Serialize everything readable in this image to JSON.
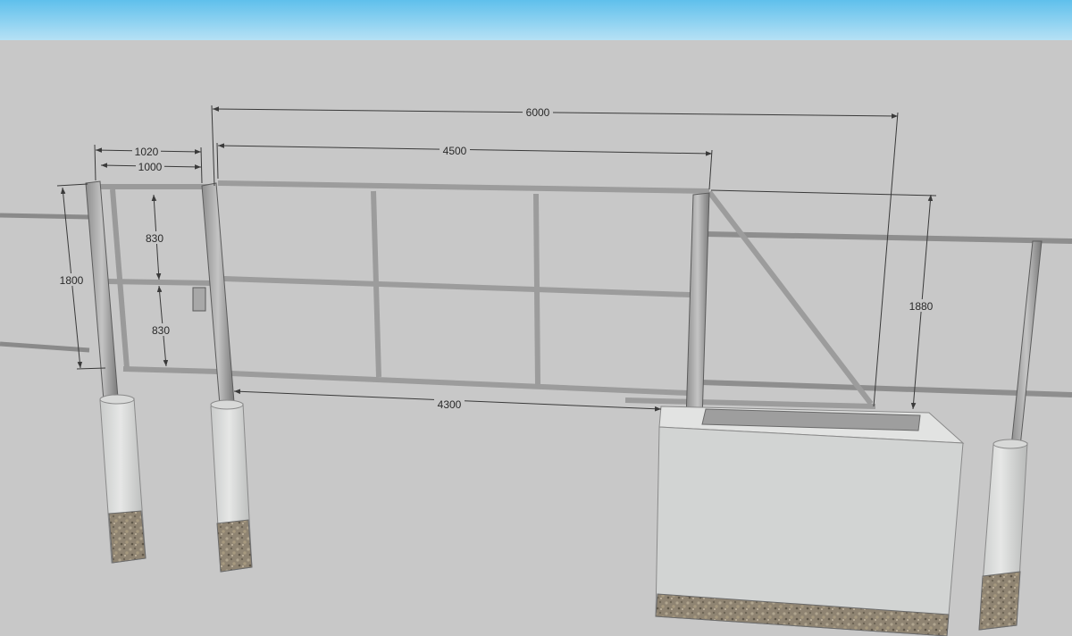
{
  "colors": {
    "sky_top": "#5fc0ec",
    "sky_bottom": "#b6e1f5",
    "ground": "#c8c8c8",
    "steel_light": "#b4b4b4",
    "steel_dark": "#6e6e6e",
    "concrete": "#d2d4d3",
    "gravel": "#8f8472",
    "dimension_line": "#3a3a3a"
  },
  "dimensions": {
    "overall_length": "6000",
    "gate_leaf_length": "4500",
    "wicket_outer_width": "1020",
    "wicket_inner_width": "1000",
    "wicket_upper_height": "830",
    "wicket_lower_height": "830",
    "wicket_height": "1800",
    "opening_width": "4300",
    "overall_height": "1880"
  }
}
